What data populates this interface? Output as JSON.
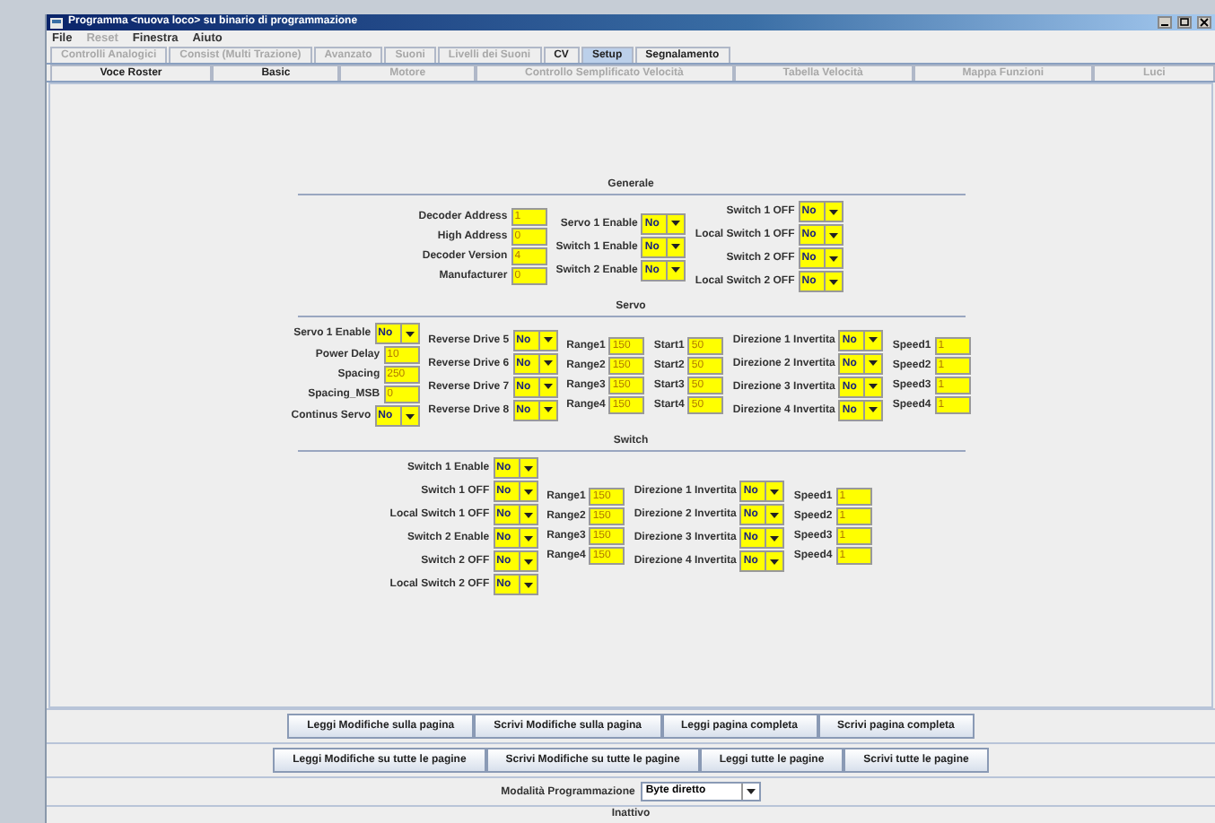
{
  "window": {
    "title": "Programma <nuova loco> su binario di programmazione"
  },
  "menu": [
    {
      "label": "File",
      "disabled": false
    },
    {
      "label": "Reset",
      "disabled": true
    },
    {
      "label": "Finestra",
      "disabled": false
    },
    {
      "label": "Aiuto",
      "disabled": false
    }
  ],
  "tabs": [
    {
      "label": "Controlli Analogici",
      "selected": false,
      "disabled": true
    },
    {
      "label": "Consist (Multi Trazione)",
      "selected": false,
      "disabled": true
    },
    {
      "label": "Avanzato",
      "selected": false,
      "disabled": true
    },
    {
      "label": "Suoni",
      "selected": false,
      "disabled": true
    },
    {
      "label": "Livelli dei Suoni",
      "selected": false,
      "disabled": true
    },
    {
      "label": "CV",
      "selected": false,
      "disabled": false
    },
    {
      "label": "Setup",
      "selected": true,
      "disabled": false
    },
    {
      "label": "Segnalamento",
      "selected": false,
      "disabled": false
    }
  ],
  "pane_tabs": [
    {
      "label": "Voce Roster",
      "disabled": false
    },
    {
      "label": "Basic",
      "disabled": false
    },
    {
      "label": "Motore",
      "disabled": true
    },
    {
      "label": "Controllo Semplificato Velocità",
      "disabled": true
    },
    {
      "label": "Tabella Velocità",
      "disabled": true
    },
    {
      "label": "Mappa Funzioni",
      "disabled": true
    },
    {
      "label": "Luci",
      "disabled": true
    }
  ],
  "sections": [
    {
      "title": "Generale",
      "columns": [
        [
          {
            "kind": "field",
            "label": "Decoder Address",
            "value": "1"
          },
          {
            "kind": "field",
            "label": "High Address",
            "value": "0"
          },
          {
            "kind": "field",
            "label": "Decoder Version",
            "value": "4"
          },
          {
            "kind": "field",
            "label": "Manufacturer",
            "value": "0"
          }
        ],
        [
          {
            "kind": "combo",
            "label": "Servo 1 Enable",
            "value": "No"
          },
          {
            "kind": "combo",
            "label": "Switch 1 Enable",
            "value": "No"
          },
          {
            "kind": "combo",
            "label": "Switch 2 Enable",
            "value": "No"
          }
        ],
        [
          {
            "kind": "combo",
            "label": "Switch 1 OFF",
            "value": "No"
          },
          {
            "kind": "combo",
            "label": "Local Switch 1 OFF",
            "value": "No"
          },
          {
            "kind": "combo",
            "label": "Switch 2 OFF",
            "value": "No"
          },
          {
            "kind": "combo",
            "label": "Local Switch 2 OFF",
            "value": "No"
          }
        ]
      ]
    },
    {
      "title": "Servo",
      "columns": [
        [
          {
            "kind": "combo",
            "label": "Servo 1 Enable",
            "value": "No"
          },
          {
            "kind": "field",
            "label": "Power Delay",
            "value": "10"
          },
          {
            "kind": "field",
            "label": "Spacing",
            "value": "250"
          },
          {
            "kind": "field",
            "label": "Spacing_MSB",
            "value": "0"
          },
          {
            "kind": "combo",
            "label": "Continus Servo",
            "value": "No"
          }
        ],
        [
          {
            "kind": "combo",
            "label": "Reverse Drive 5",
            "value": "No"
          },
          {
            "kind": "combo",
            "label": "Reverse Drive 6",
            "value": "No"
          },
          {
            "kind": "combo",
            "label": "Reverse Drive 7",
            "value": "No"
          },
          {
            "kind": "combo",
            "label": "Reverse Drive 8",
            "value": "No"
          }
        ],
        [
          {
            "kind": "field",
            "label": "Range1",
            "value": "150"
          },
          {
            "kind": "field",
            "label": "Range2",
            "value": "150"
          },
          {
            "kind": "field",
            "label": "Range3",
            "value": "150"
          },
          {
            "kind": "field",
            "label": "Range4",
            "value": "150"
          }
        ],
        [
          {
            "kind": "field",
            "label": "Start1",
            "value": "50"
          },
          {
            "kind": "field",
            "label": "Start2",
            "value": "50"
          },
          {
            "kind": "field",
            "label": "Start3",
            "value": "50"
          },
          {
            "kind": "field",
            "label": "Start4",
            "value": "50"
          }
        ],
        [
          {
            "kind": "combo",
            "label": "Direzione 1 Invertita",
            "value": "No"
          },
          {
            "kind": "combo",
            "label": "Direzione 2 Invertita",
            "value": "No"
          },
          {
            "kind": "combo",
            "label": "Direzione 3 Invertita",
            "value": "No"
          },
          {
            "kind": "combo",
            "label": "Direzione 4 Invertita",
            "value": "No"
          }
        ],
        [
          {
            "kind": "field",
            "label": "Speed1",
            "value": "1"
          },
          {
            "kind": "field",
            "label": "Speed2",
            "value": "1"
          },
          {
            "kind": "field",
            "label": "Speed3",
            "value": "1"
          },
          {
            "kind": "field",
            "label": "Speed4",
            "value": "1"
          }
        ]
      ]
    },
    {
      "title": "Switch",
      "columns": [
        [
          {
            "kind": "combo",
            "label": "Switch 1 Enable",
            "value": "No"
          },
          {
            "kind": "combo",
            "label": "Switch 1 OFF",
            "value": "No"
          },
          {
            "kind": "combo",
            "label": "Local Switch 1 OFF",
            "value": "No"
          },
          {
            "kind": "combo",
            "label": "Switch 2 Enable",
            "value": "No"
          },
          {
            "kind": "combo",
            "label": "Switch 2 OFF",
            "value": "No"
          },
          {
            "kind": "combo",
            "label": "Local Switch 2 OFF",
            "value": "No"
          }
        ],
        [
          {
            "kind": "field",
            "label": "Range1",
            "value": "150"
          },
          {
            "kind": "field",
            "label": "Range2",
            "value": "150"
          },
          {
            "kind": "field",
            "label": "Range3",
            "value": "150"
          },
          {
            "kind": "field",
            "label": "Range4",
            "value": "150"
          }
        ],
        [
          {
            "kind": "combo",
            "label": "Direzione 1 Invertita",
            "value": "No"
          },
          {
            "kind": "combo",
            "label": "Direzione 2 Invertita",
            "value": "No"
          },
          {
            "kind": "combo",
            "label": "Direzione 3 Invertita",
            "value": "No"
          },
          {
            "kind": "combo",
            "label": "Direzione 4 Invertita",
            "value": "No"
          }
        ],
        [
          {
            "kind": "field",
            "label": "Speed1",
            "value": "1"
          },
          {
            "kind": "field",
            "label": "Speed2",
            "value": "1"
          },
          {
            "kind": "field",
            "label": "Speed3",
            "value": "1"
          },
          {
            "kind": "field",
            "label": "Speed4",
            "value": "1"
          }
        ]
      ]
    }
  ],
  "page_buttons": [
    "Leggi Modifiche sulla pagina",
    "Scrivi Modifiche sulla pagina",
    "Leggi pagina completa",
    "Scrivi pagina completa"
  ],
  "all_pages_buttons": [
    "Leggi Modifiche su tutte le pagine",
    "Scrivi Modifiche su tutte le pagine",
    "Leggi tutte le pagine",
    "Scrivi tutte le pagine"
  ],
  "programming_mode": {
    "label": "Modalità Programmazione",
    "value": "Byte diretto"
  },
  "status_bar": "Inattivo"
}
